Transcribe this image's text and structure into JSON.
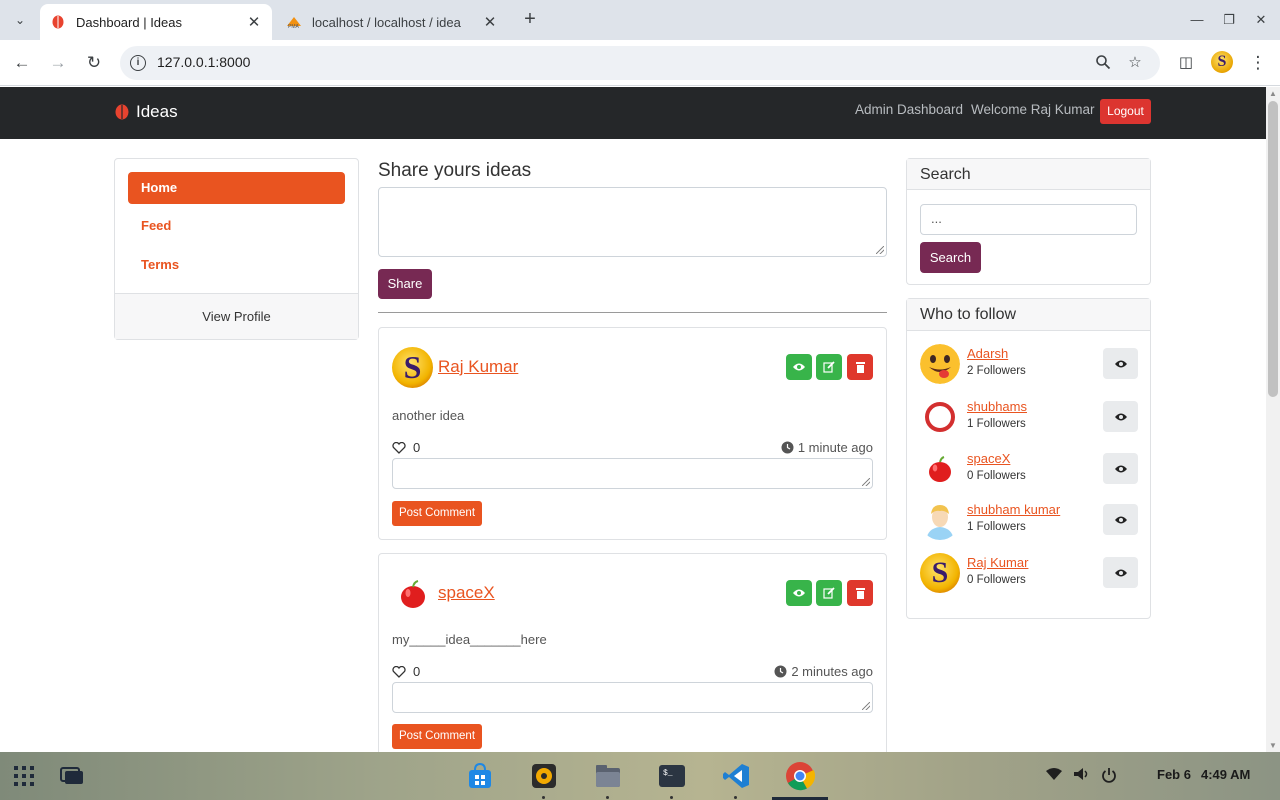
{
  "browser": {
    "tabs": [
      {
        "title": "Dashboard | Ideas",
        "favicon": "brain-icon"
      },
      {
        "title": "localhost / localhost / idea",
        "favicon": "phpmyadmin-icon"
      }
    ],
    "url": "127.0.0.1:8000"
  },
  "navbar": {
    "brand": "Ideas",
    "admin_link": "Admin Dashboard",
    "welcome": "Welcome Raj Kumar",
    "logout": "Logout"
  },
  "sidebar": {
    "items": [
      {
        "label": "Home",
        "active": true
      },
      {
        "label": "Feed",
        "active": false
      },
      {
        "label": "Terms",
        "active": false
      }
    ],
    "footer": "View Profile"
  },
  "share": {
    "title": "Share yours ideas",
    "button": "Share"
  },
  "posts": [
    {
      "author": "Raj Kumar",
      "avatar": "S",
      "text": "another idea",
      "likes": "0",
      "time": "1 minute ago",
      "comment_button": "Post Comment"
    },
    {
      "author": "spaceX",
      "avatar": "apple",
      "text": "my_____idea_______here",
      "likes": "0",
      "time": "2 minutes ago",
      "comment_button": "Post Comment"
    }
  ],
  "search": {
    "title": "Search",
    "placeholder": "...",
    "button": "Search"
  },
  "who_to_follow": {
    "title": "Who to follow",
    "users": [
      {
        "name": "Adarsh",
        "followers": "2 Followers",
        "avatar": "emoji-face-icon"
      },
      {
        "name": "shubhams",
        "followers": "1 Followers",
        "avatar": "ring-icon"
      },
      {
        "name": "spaceX",
        "followers": "0 Followers",
        "avatar": "apple-icon"
      },
      {
        "name": "shubham kumar",
        "followers": "1 Followers",
        "avatar": "person-icon"
      },
      {
        "name": "Raj Kumar",
        "followers": "0 Followers",
        "avatar": "s-logo-icon"
      }
    ]
  },
  "taskbar": {
    "date": "Feb 6",
    "time": "4:49 AM"
  },
  "colors": {
    "primary": "#e95420",
    "secondary": "#772953",
    "success": "#38b44a",
    "danger": "#df382c",
    "navbar": "#252729"
  }
}
